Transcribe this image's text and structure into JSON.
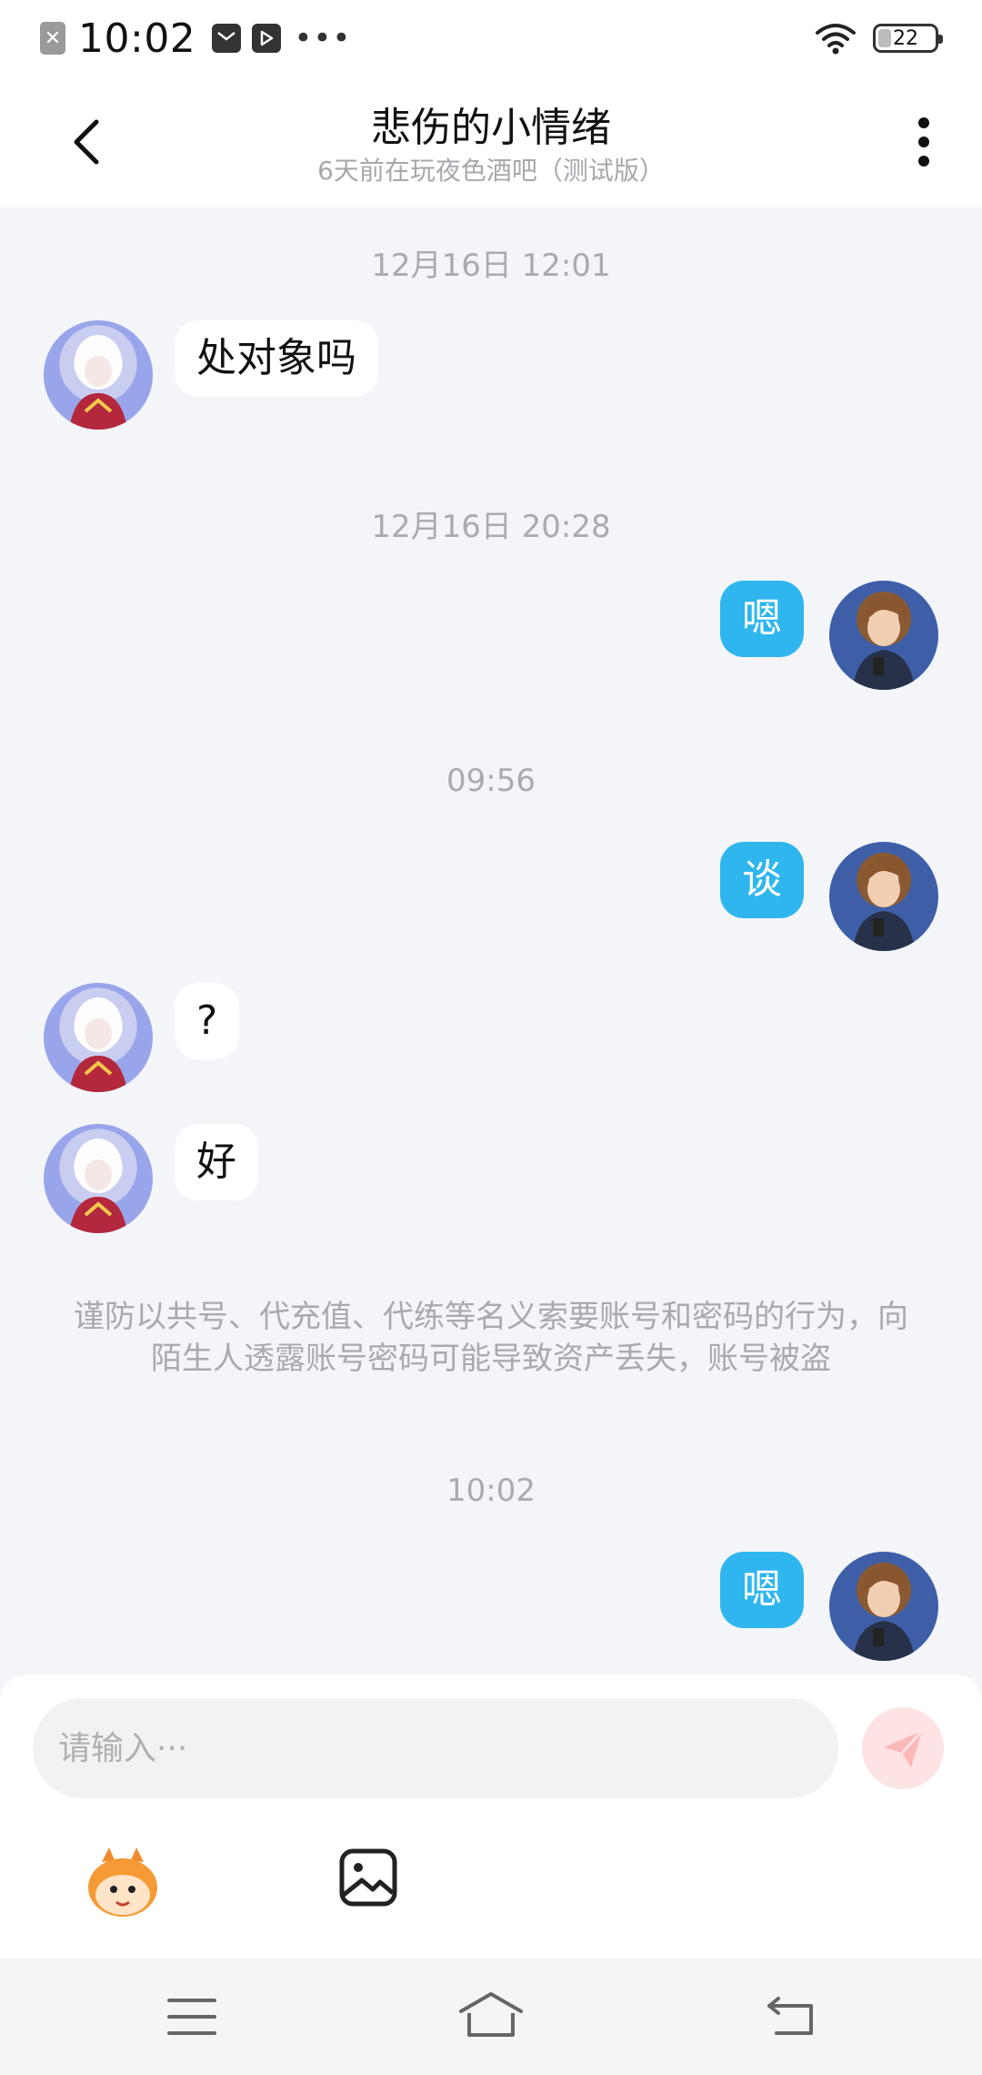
{
  "status_bar": {
    "time": "10:02",
    "battery": "22",
    "icons": [
      "notification-x-icon",
      "mail-icon",
      "play-icon",
      "more-dots-icon",
      "wifi-icon",
      "battery-icon"
    ]
  },
  "header": {
    "title": "悲伤的小情绪",
    "subtitle": "6天前在玩夜色酒吧（测试版）"
  },
  "chat": {
    "items": [
      {
        "type": "timestamp",
        "text": "12月16日 12:01"
      },
      {
        "type": "message",
        "side": "left",
        "text": "处对象吗"
      },
      {
        "type": "timestamp",
        "text": "12月16日 20:28"
      },
      {
        "type": "message",
        "side": "right",
        "text": "嗯"
      },
      {
        "type": "timestamp",
        "text": "09:56"
      },
      {
        "type": "message",
        "side": "right",
        "text": "谈"
      },
      {
        "type": "message",
        "side": "left",
        "text": "?"
      },
      {
        "type": "message",
        "side": "left",
        "text": "好"
      },
      {
        "type": "notice",
        "text": "谨防以共号、代充值、代练等名义索要账号和密码的行为，向陌生人透露账号密码可能导致资产丢失，账号被盗"
      },
      {
        "type": "timestamp",
        "text": "10:02"
      },
      {
        "type": "message",
        "side": "right",
        "text": "嗯"
      }
    ]
  },
  "composer": {
    "placeholder": "请输入···",
    "value": ""
  },
  "colors": {
    "outgoing_bubble": "#2fb6ef",
    "incoming_bubble": "#ffffff",
    "chat_background": "#f3f5f9",
    "send_button": "#fde3e3"
  }
}
